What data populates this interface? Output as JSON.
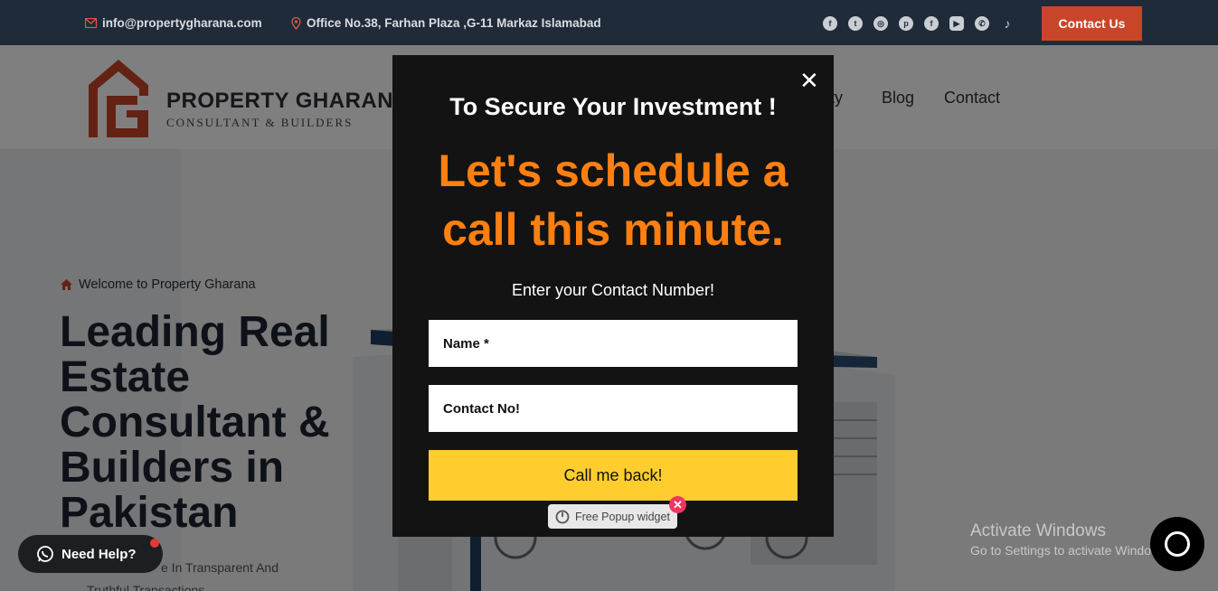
{
  "topbar": {
    "email": "info@propertygharana.com",
    "office": "Office No.38, Farhan Plaza ,G-11 Markaz Islamabad",
    "socials": [
      "facebook-icon",
      "twitter-icon",
      "instagram-icon",
      "pinterest-icon",
      "facebook-icon",
      "youtube-icon",
      "whatsapp-icon",
      "tiktok-icon"
    ],
    "contact_button": "Contact Us"
  },
  "header": {
    "logo_title": "PROPERTY GHARANA",
    "logo_subtitle": "CONSULTANT & BUILDERS",
    "nav": {
      "property": "rty",
      "blog": "Blog",
      "contact": "Contact"
    }
  },
  "hero": {
    "welcome": "Welcome to Property Gharana",
    "title": "Leading Real Estate Consultant & Builders in Pakistan",
    "subtitle_line1": "e In Transparent And",
    "subtitle_line2": "Truthful Transactions"
  },
  "popup": {
    "heading": "To Secure Your Investment !",
    "headline": "Let's schedule a call this minute.",
    "prompt": "Enter your Contact Number!",
    "name_placeholder": "Name *",
    "contact_placeholder": "Contact No!",
    "submit_label": "Call me back!",
    "close_symbol": "✕"
  },
  "widget_tag": {
    "label": "Free Popup widget",
    "close_symbol": "✕"
  },
  "need_help": {
    "label": "Need Help?"
  },
  "activate_windows": {
    "title": "Activate Windows",
    "subtitle": "Go to Settings to activate Windows."
  },
  "colors": {
    "topbar_bg": "#1f2b38",
    "accent_orange": "#ff7f11",
    "button_yellow": "#ffcd2e",
    "contact_btn": "#c9452a"
  }
}
